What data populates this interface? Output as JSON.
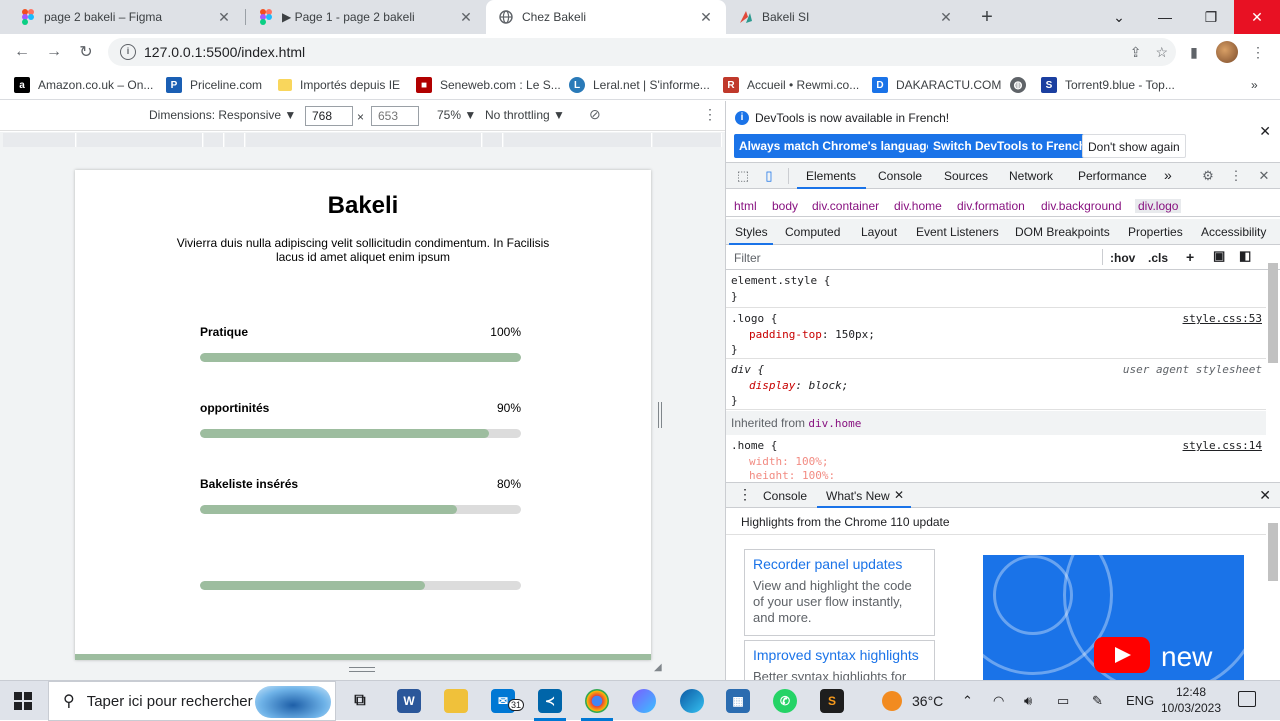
{
  "tabs": [
    {
      "title": "page 2 bakeli – Figma",
      "icon": "figma-icon"
    },
    {
      "title": "▶ Page 1 - page 2 bakeli",
      "icon": "figma-icon"
    },
    {
      "title": "Chez Bakeli",
      "icon": "globe-icon"
    },
    {
      "title": "Bakeli SI",
      "icon": "bakeli-icon"
    }
  ],
  "address": {
    "url": "127.0.0.1:5500/index.html"
  },
  "bookmarks": [
    {
      "label": "Amazon.co.uk – On...",
      "icon": "amazon-icon",
      "color": "#000000"
    },
    {
      "label": "Priceline.com",
      "icon": "priceline-icon",
      "color": "#1a5fb4"
    },
    {
      "label": "Importés depuis IE",
      "icon": "folder-icon",
      "color": "#f9d65c"
    },
    {
      "label": "Seneweb.com : Le S...",
      "icon": "seneweb-icon",
      "color": "#b10000"
    },
    {
      "label": "Leral.net | S'informe...",
      "icon": "leral-icon",
      "color": "#2a7ab8"
    },
    {
      "label": "Accueil • Rewmi.co...",
      "icon": "rewmi-icon",
      "color": "#c0392b"
    },
    {
      "label": "DAKARACTU.COM",
      "icon": "dakaractu-icon",
      "color": "#1a73e8"
    },
    {
      "label": "",
      "icon": "globe-icon",
      "color": "#5f6368"
    },
    {
      "label": "Torrent9.blue - Top...",
      "icon": "torrent9-icon",
      "color": "#1b3fa0"
    }
  ],
  "device_toolbar": {
    "dimensions": "Dimensions: Responsive ▼",
    "width": "768",
    "height_placeholder": "653",
    "times": "×",
    "zoom": "75% ▼",
    "throttling": "No throttling ▼"
  },
  "page": {
    "title": "Bakeli",
    "description": "Vivierra duis nulla adipiscing velit sollicitudin condimentum. In Facilisis lacus id amet aliquet enim ipsum",
    "skills": [
      {
        "label": "Pratique",
        "percent_text": "100%",
        "value": 100
      },
      {
        "label": "opportinités",
        "percent_text": "90%",
        "value": 90
      },
      {
        "label": "Bakeliste insérés",
        "percent_text": "80%",
        "value": 80
      },
      {
        "label": "",
        "percent_text": "",
        "value": 70
      }
    ]
  },
  "devtools": {
    "infobar": {
      "message": "DevTools is now available in French!",
      "btn_match": "Always match Chrome's language",
      "btn_switch": "Switch DevTools to French",
      "btn_dismiss": "Don't show again"
    },
    "main_tabs": [
      "Elements",
      "Console",
      "Sources",
      "Network",
      "Performance",
      "»"
    ],
    "breadcrumbs": [
      "html",
      "body",
      "div.container",
      "div.home",
      "div.formation",
      "div.background",
      "div.logo"
    ],
    "sub_tabs": [
      "Styles",
      "Computed",
      "Layout",
      "Event Listeners",
      "DOM Breakpoints",
      "Properties",
      "Accessibility"
    ],
    "filter_placeholder": "Filter",
    "filter_tools": [
      ":hov",
      ".cls",
      "+"
    ],
    "styles": {
      "element_style": "element.style {",
      "close_brace": "}",
      "logo_selector": ".logo {",
      "logo_prop": "padding-top",
      "logo_value": ": 150px;",
      "logo_source": "style.css:53",
      "div_selector": "div {",
      "div_prop": "display",
      "div_value": ": block;",
      "div_source": "user agent stylesheet",
      "inherited_label": "Inherited from ",
      "inherited_selector": "div.home",
      "home_selector": ".home {",
      "home_source": "style.css:14",
      "home_width": "width: 100%;",
      "home_height": "height: 100%;"
    },
    "drawer": {
      "tabs": [
        "Console",
        "What's New"
      ],
      "header": "Highlights from the Chrome 110 update",
      "cards": [
        {
          "title": "Recorder panel updates",
          "body": "View and highlight the code of your user flow instantly, and more."
        },
        {
          "title": "Improved syntax highlights",
          "body": "Better syntax highlights for"
        }
      ],
      "promo_text": "new"
    }
  },
  "taskbar": {
    "search_placeholder": "Taper ici pour rechercher",
    "mail_badge": "31",
    "temperature": "36°C",
    "language": "ENG",
    "time": "12:48",
    "date": "10/03/2023"
  },
  "colors": {
    "bar_fill": "#9dbd9f",
    "bar_track": "#dcdcdc",
    "devtools_accent": "#1a73e8"
  }
}
